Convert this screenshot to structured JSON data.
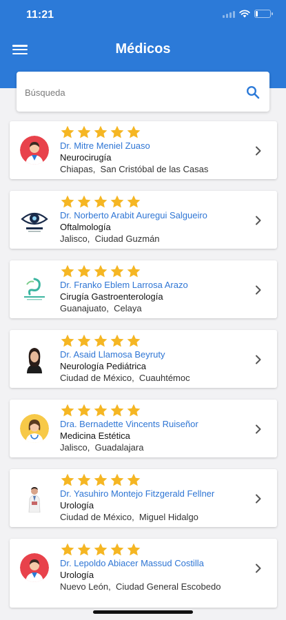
{
  "status": {
    "time": "11:21"
  },
  "header": {
    "title": "Médicos"
  },
  "search": {
    "placeholder": "Búsqueda",
    "value": ""
  },
  "colors": {
    "primary": "#2c7ad8",
    "star": "#f5b623",
    "link": "#2e75d4"
  },
  "doctors": [
    {
      "rating": 5,
      "name": "Dr. Mitre Meniel Zuaso",
      "specialty": "Neurocirugía",
      "state": "Chiapas",
      "city": "San Cristóbal de las Casas",
      "avatar": "doctor-illustration-icon"
    },
    {
      "rating": 5,
      "name": "Dr. Norberto Arabit Auregui Salgueiro",
      "specialty": "Oftalmología",
      "state": "Jalisco",
      "city": "Ciudad Guzmán",
      "avatar": "ophthalmology-logo-icon"
    },
    {
      "rating": 5,
      "name": "Dr. Franko Eblem Larrosa Arazo",
      "specialty": "Cirugía Gastroenterología",
      "state": "Guanajuato",
      "city": "Celaya",
      "avatar": "gastro-logo-icon"
    },
    {
      "rating": 5,
      "name": "Dr. Asaid Llamosa Beyruty",
      "specialty": "Neurología Pediátrica",
      "state": "Ciudad de México",
      "city": "Cuauhtémoc",
      "avatar": "doctor-photo-icon"
    },
    {
      "rating": 5,
      "name": "Dra. Bernadette Vincents Ruiseñor",
      "specialty": "Medicina Estética",
      "state": "Jalisco",
      "city": "Guadalajara",
      "avatar": "female-doctor-illustration-icon"
    },
    {
      "rating": 5,
      "name": "Dr. Yasuhiro Montejo Fitzgerald Fellner",
      "specialty": "Urología",
      "state": "Ciudad de México",
      "city": "Miguel Hidalgo",
      "avatar": "doctor-standing-photo-icon"
    },
    {
      "rating": 5,
      "name": "Dr. Lepoldo Abiacer Massud Costilla",
      "specialty": "Urología",
      "state": "Nuevo León",
      "city": "Ciudad General Escobedo",
      "avatar": "doctor-illustration-icon"
    }
  ]
}
